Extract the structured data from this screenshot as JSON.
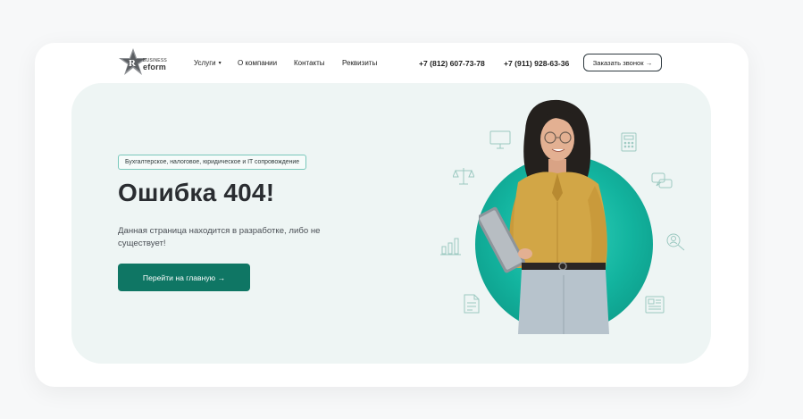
{
  "header": {
    "logo": {
      "top": "BUSINESS",
      "bottom": "eform"
    },
    "nav": {
      "services": "Услуги",
      "about": "О компании",
      "contacts": "Контакты",
      "requisites": "Реквизиты"
    },
    "phones": [
      "+7 (812) 607-73-78",
      "+7 (911) 928-63-36"
    ],
    "callback_label": "Заказать звонок →"
  },
  "hero": {
    "tag": "Бухгалтерское, налоговое, юридическое и IT сопровождение",
    "title": "Ошибка 404!",
    "description": "Данная страница находится в разработке, либо не существует!",
    "button_label": "Перейти на главную →"
  },
  "colors": {
    "accent": "#0f7664",
    "hero_bg": "#eef5f4",
    "circle": "#13b49f",
    "tag_border": "#79c8bb"
  },
  "icons": [
    "monitor-icon",
    "calculator-icon",
    "scales-icon",
    "chat-icon",
    "bar-chart-icon",
    "search-person-icon",
    "document-icon",
    "newspaper-icon"
  ]
}
